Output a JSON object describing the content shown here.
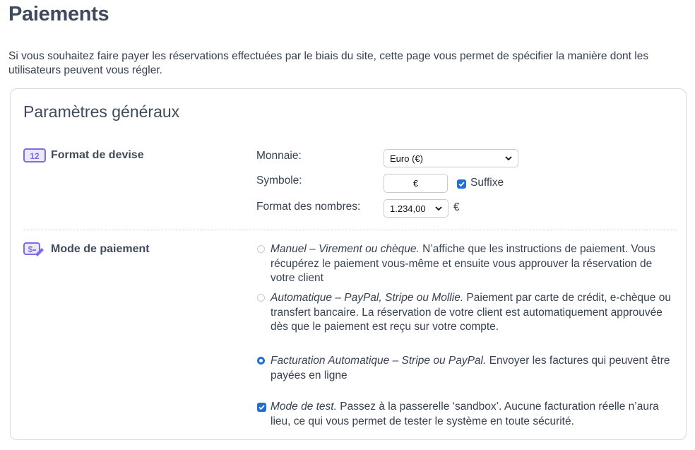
{
  "page": {
    "title": "Paiements",
    "intro": "Si vous souhaitez faire payer les réservations effectuées par le biais du site, cette page vous permet de spécifier la manière dont les utilisateurs peuvent vous régler."
  },
  "card": {
    "title": "Paramètres généraux",
    "currency_section": {
      "heading": "Format de devise",
      "icon": "number-12-icon",
      "currency_label": "Monnaie:",
      "currency_value": "Euro (€)",
      "symbol_label": "Symbole:",
      "symbol_value": "€",
      "suffix_label": "Suffixe",
      "suffix_checked": true,
      "number_format_label": "Format des nombres:",
      "number_format_value": "1.234,00",
      "number_format_symbol": "€"
    },
    "payment_section": {
      "heading": "Mode de paiement",
      "icon": "dollar-pen-icon",
      "options": [
        {
          "title": "Manuel – Virement ou chèque.",
          "desc": " N’affiche que les instructions de paiement. Vous récupérez le paiement vous-même et ensuite vous approuver la réservation de votre client",
          "selected": false
        },
        {
          "title": "Automatique – PayPal, Stripe ou Mollie.",
          "desc": " Paiement par carte de crédit, e-chèque ou transfert bancaire. La réservation de votre client est automatiquement approuvée dès que le paiement est reçu sur votre compte.",
          "selected": false
        },
        {
          "title": "Facturation Automatique – Stripe ou PayPal.",
          "desc": " Envoyer les factures qui peuvent être payées en ligne",
          "selected": true
        }
      ],
      "test_mode": {
        "title": "Mode de test.",
        "desc": " Passez à la passerelle ‘sandbox’. Aucune facturation réelle n’aura lieu, ce qui vous permet de tester le système en toute sécurité.",
        "checked": true
      }
    }
  },
  "colors": {
    "accent": "#1f6fd6",
    "icon_purple": "#7b6ee6",
    "heading": "#3f4a5c"
  }
}
